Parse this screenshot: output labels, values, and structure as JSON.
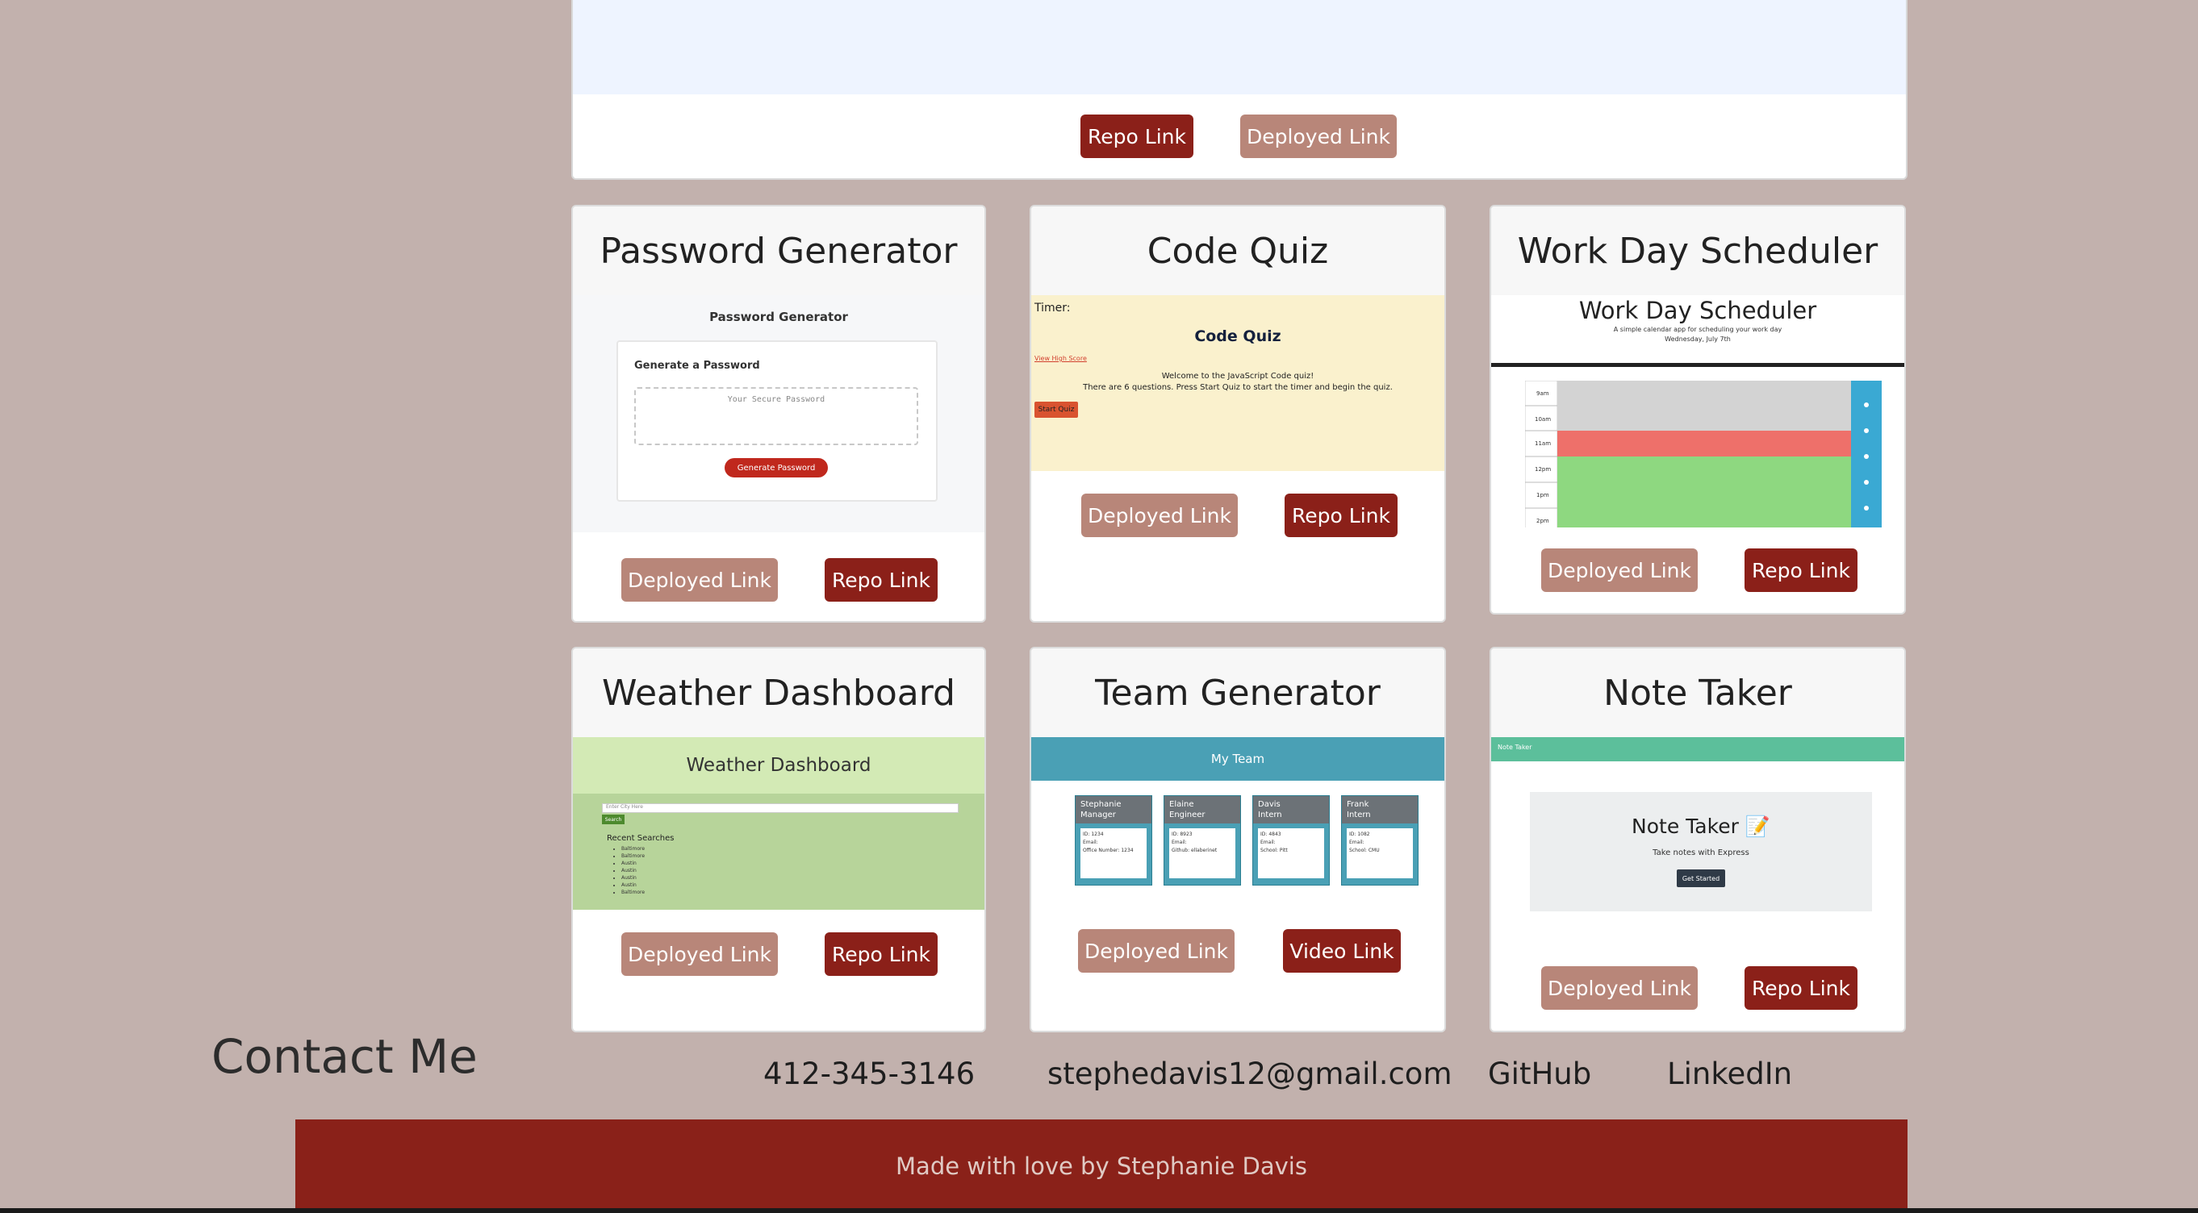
{
  "top_card": {
    "repo_label": "Repo Link",
    "deployed_label": "Deployed Link"
  },
  "projects": [
    {
      "title": "Password Generator",
      "buttons": [
        "Deployed Link",
        "Repo Link"
      ],
      "thumb": {
        "title": "Password Generator",
        "heading": "Generate a Password",
        "placeholder": "Your Secure Password",
        "button": "Generate Password"
      }
    },
    {
      "title": "Code Quiz",
      "buttons": [
        "Deployed Link",
        "Repo Link"
      ],
      "thumb": {
        "timer": "Timer:",
        "title": "Code Quiz",
        "highscores": "View High Score",
        "welcome_1": "Welcome to the JavaScript Code quiz!",
        "welcome_2": "There are 6 questions. Press Start Quiz to start the timer and begin the quiz.",
        "start": "Start Quiz"
      }
    },
    {
      "title": "Work Day Scheduler",
      "buttons": [
        "Deployed Link",
        "Repo Link"
      ],
      "thumb": {
        "title": "Work Day Scheduler",
        "subtitle": "A simple calendar app for scheduling your work day",
        "date": "Wednesday, July 7th",
        "hours": [
          "9am",
          "10am",
          "11am",
          "12pm",
          "1pm",
          "2pm"
        ]
      }
    },
    {
      "title": "Weather Dashboard",
      "buttons": [
        "Deployed Link",
        "Repo Link"
      ],
      "thumb": {
        "title": "Weather Dashboard",
        "input_placeholder": "Enter City Here",
        "search": "Search",
        "recent": "Recent Searches",
        "cities": [
          "Baltimore",
          "Baltimore",
          "Austin",
          "Austin",
          "Austin",
          "Austin",
          "Baltimore"
        ]
      }
    },
    {
      "title": "Team Generator",
      "buttons": [
        "Deployed Link",
        "Video Link"
      ],
      "thumb": {
        "title": "My Team",
        "members": [
          {
            "name": "Stephanie",
            "role": "Manager",
            "id": "ID: 1234",
            "email": "Email:",
            "extra": "Office Number: 1234"
          },
          {
            "name": "Elaine",
            "role": "Engineer",
            "id": "ID: 8923",
            "email": "Email:",
            "extra": "Github: ellaberinet"
          },
          {
            "name": "Davis",
            "role": "Intern",
            "id": "ID: 4843",
            "email": "Email:",
            "extra": "School: Pitt"
          },
          {
            "name": "Frank",
            "role": "Intern",
            "id": "ID: 1082",
            "email": "Email:",
            "extra": "School: CMU"
          }
        ]
      }
    },
    {
      "title": "Note Taker",
      "buttons": [
        "Deployed Link",
        "Repo Link"
      ],
      "thumb": {
        "header": "Note Taker",
        "title": "Note Taker 📝",
        "subtitle": "Take notes with Express",
        "button": "Get Started"
      }
    }
  ],
  "contact": {
    "title": "Contact Me",
    "phone": "412-345-3146",
    "email": "stephedavis12@gmail.com",
    "github": "GitHub",
    "linkedin": "LinkedIn"
  },
  "footer": {
    "text": "Made with love by Stephanie Davis"
  },
  "colors": {
    "page_bg": "#c2b1ad",
    "repo_button": "#8b2019",
    "deployed_button": "#b88679",
    "footer_bg": "#8a2119"
  }
}
